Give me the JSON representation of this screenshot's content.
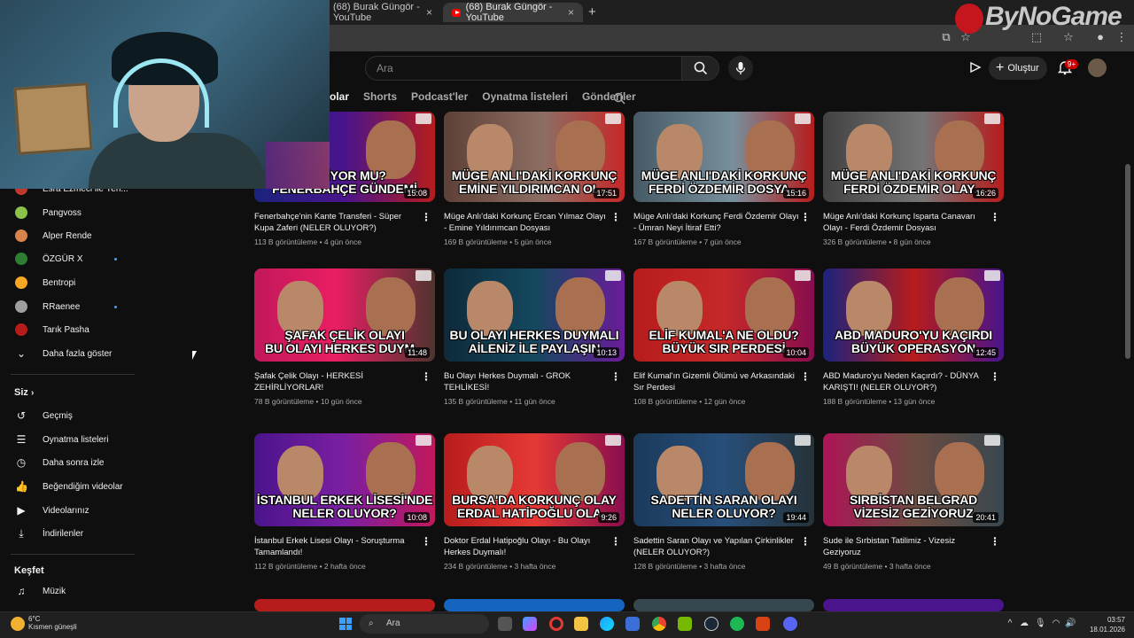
{
  "browser": {
    "tabs": [
      {
        "label": "(68) Burak Güngör - YouTube",
        "active": false
      },
      {
        "label": "(68) Burak Güngör - YouTube",
        "active": true
      }
    ],
    "new_tab_label": "+"
  },
  "watermark": {
    "text": "ByNoGame"
  },
  "header": {
    "search_placeholder": "Ara",
    "create_label": "Oluştur",
    "notification_count": "9+"
  },
  "channel_tabs": [
    {
      "label": "olar",
      "active": true
    },
    {
      "label": "Shorts",
      "active": false
    },
    {
      "label": "Podcast'ler",
      "active": false
    },
    {
      "label": "Oynatma listeleri",
      "active": false
    },
    {
      "label": "Gönderiler",
      "active": false
    }
  ],
  "sidebar": {
    "subscriptions": [
      {
        "label": "Esra Ezmeci ile Yen...",
        "color": "#c0392b",
        "new": false
      },
      {
        "label": "Pangvoss",
        "color": "#8bc34a",
        "new": false
      },
      {
        "label": "Alper Rende",
        "color": "#d9844a",
        "new": false
      },
      {
        "label": "ÖZGÜR X",
        "color": "#2e7d32",
        "new": true
      },
      {
        "label": "Bentropi",
        "color": "#f5a623",
        "new": false
      },
      {
        "label": "RRaenee",
        "color": "#9e9e9e",
        "new": true
      },
      {
        "label": "Tarık Pasha",
        "color": "#b71c1c",
        "new": false
      }
    ],
    "show_more_label": "Daha fazla göster",
    "you_heading": "Siz",
    "you_items": [
      {
        "label": "Geçmiş",
        "icon": "history-icon",
        "glyph": "↺"
      },
      {
        "label": "Oynatma listeleri",
        "icon": "playlist-icon",
        "glyph": "☰"
      },
      {
        "label": "Daha sonra izle",
        "icon": "clock-icon",
        "glyph": "◷"
      },
      {
        "label": "Beğendiğim videolar",
        "icon": "thumbs-up-icon",
        "glyph": "👍"
      },
      {
        "label": "Videolarınız",
        "icon": "video-icon",
        "glyph": "▶"
      },
      {
        "label": "İndirilenler",
        "icon": "download-icon",
        "glyph": "⤓"
      }
    ],
    "explore_heading": "Keşfet",
    "explore_items": [
      {
        "label": "Müzik",
        "icon": "music-icon",
        "glyph": "♫"
      }
    ]
  },
  "videos": [
    {
      "caption1": "SELİYOR MU?",
      "caption2": "FENERBAHÇE GÜNDEMİ",
      "duration": "15:08",
      "title": "Fenerbahçe'nin Kante Transferi - Süper Kupa Zaferi (NELER OLUYOR?)",
      "views": "113 B görüntüleme",
      "age": "4 gün önce",
      "bg": "linear-gradient(90deg,#1a237e,#4a148c 50%,#b71c1c)"
    },
    {
      "caption1": "MÜGE ANLI'DAKİ KORKUNÇ",
      "caption2": "EMİNE YILDIRIMCAN OL...",
      "duration": "17:51",
      "title": "Müge Anlı'daki Korkunç Ercan Yılmaz Olayı - Emine Yıldırımcan Dosyası",
      "views": "169 B görüntüleme",
      "age": "5 gün önce",
      "bg": "linear-gradient(90deg,#5d4037,#8d6e63 55%,#c62828)"
    },
    {
      "caption1": "MÜGE ANLI'DAKİ KORKUNÇ",
      "caption2": "FERDİ ÖZDEMİR DOSYA...",
      "duration": "15:16",
      "title": "Müge Anlı'daki Korkunç Ferdi Özdemir Olayı - Ümran Neyi İtiraf Etti?",
      "views": "167 B görüntüleme",
      "age": "7 gün önce",
      "bg": "linear-gradient(90deg,#455a64,#78909c 55%,#b71c1c)"
    },
    {
      "caption1": "MÜGE ANLI'DAKİ KORKUNÇ",
      "caption2": "FERDİ ÖZDEMİR OLAY...",
      "duration": "16:26",
      "title": "Müge Anlı'daki Korkunç Isparta Canavarı Olayı - Ferdi Özdemir Dosyası",
      "views": "326 B görüntüleme",
      "age": "8 gün önce",
      "bg": "linear-gradient(90deg,#424242,#757575 55%,#b71c1c)"
    },
    {
      "caption1": "ŞAFAK ÇELİK OLAYI",
      "caption2": "BU OLAYI HERKES DUYM...",
      "duration": "11:48",
      "title": "Şafak Çelik Olayı - HERKESİ ZEHİRLİYORLAR!",
      "views": "78 B görüntüleme",
      "age": "10 gün önce",
      "bg": "linear-gradient(90deg,#c2185b,#e91e63 45%,#4e342e)"
    },
    {
      "caption1": "BU OLAYI HERKES DUYMALI",
      "caption2": "AİLENİZ İLE PAYLAŞIN",
      "duration": "10:13",
      "title": "Bu Olayı Herkes Duymalı - GROK TEHLİKESİ!",
      "views": "135 B görüntüleme",
      "age": "11 gün önce",
      "bg": "linear-gradient(90deg,#0d2a3a,#14485e 50%,#6a1b9a)"
    },
    {
      "caption1": "ELİF KUMAL'A NE OLDU?",
      "caption2": "BÜYÜK SIR PERDESİ",
      "duration": "10:04",
      "title": "Elif Kumal'ın Gizemli Ölümü ve Arkasındaki Sır Perdesi",
      "views": "108 B görüntüleme",
      "age": "12 gün önce",
      "bg": "linear-gradient(90deg,#b71c1c,#c62828 50%,#880e4f)"
    },
    {
      "caption1": "ABD MADURO'YU KAÇIRDI",
      "caption2": "BÜYÜK OPERASYON",
      "duration": "12:45",
      "title": "ABD Maduro'yu Neden Kaçırdı? - DÜNYA KARIŞTI! (NELER OLUYOR?)",
      "views": "188 B görüntüleme",
      "age": "13 gün önce",
      "bg": "linear-gradient(90deg,#1a237e,#b71c1c 50%,#4a148c)"
    },
    {
      "caption1": "İSTANBUL ERKEK LİSESİ'NDE",
      "caption2": "NELER OLUYOR?",
      "duration": "10:08",
      "title": "İstanbul Erkek Lisesi Olayı - Soruşturma Tamamlandı!",
      "views": "112 B görüntüleme",
      "age": "2 hafta önce",
      "bg": "linear-gradient(90deg,#4a148c,#7b1fa2 50%,#c2185b)"
    },
    {
      "caption1": "BURSA'DA KORKUNÇ OLAY",
      "caption2": "ERDAL HATİPOĞLU OLA...",
      "duration": "9:26",
      "title": "Doktor Erdal Hatipoğlu Olayı - Bu Olayı Herkes Duymalı!",
      "views": "234 B görüntüleme",
      "age": "3 hafta önce",
      "bg": "linear-gradient(90deg,#b71c1c,#e53935 50%,#880e4f)"
    },
    {
      "caption1": "SADETTİN SARAN OLAYI",
      "caption2": "NELER OLUYOR?",
      "duration": "19:44",
      "title": "Sadettin Saran Olayı ve Yapılan Çirkinlikler (NELER OLUYOR?)",
      "views": "128 B görüntüleme",
      "age": "3 hafta önce",
      "bg": "linear-gradient(90deg,#1b3a5c,#274f7a 50%,#263238)"
    },
    {
      "caption1": "SIRBİSTAN BELGRAD",
      "caption2": "VİZESİZ GEZİYORUZ",
      "duration": "20:41",
      "title": "Sude ile Sırbistan Tatilimiz - Vizesiz Geziyoruz",
      "views": "49 B görüntüleme",
      "age": "3 hafta önce",
      "bg": "linear-gradient(90deg,#ad1457,#6d4c41 50%,#37474f)"
    }
  ],
  "taskbar": {
    "temperature": "6°C",
    "condition": "Kısmen güneşli",
    "search_label": "Ara",
    "time": "03:57",
    "date": "18.01.2026"
  }
}
